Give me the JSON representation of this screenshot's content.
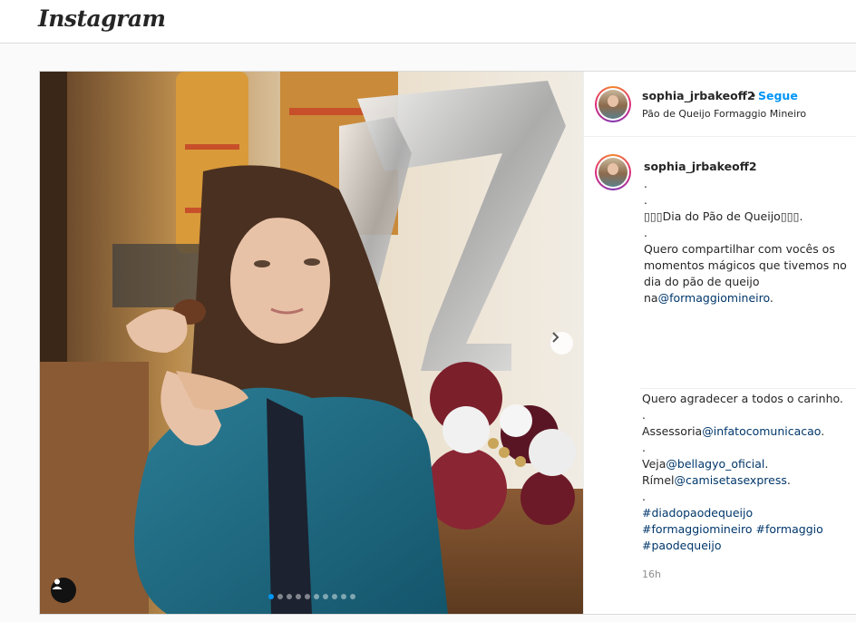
{
  "app": {
    "logo_text": "Instagram"
  },
  "post": {
    "username": "sophia_jrbakeoff2",
    "follow_separator": "•",
    "follow_label": "Segue",
    "location": "Pão de Queijo Formaggio Mineiro",
    "carousel": {
      "total": 10,
      "active_index": 0
    },
    "caption_username": "sophia_jrbakeoff2",
    "caption_lines": [
      {
        "text": ".",
        "link": ""
      },
      {
        "text": ".",
        "link": ""
      },
      {
        "text": "▯▯▯Dia do Pão de Queijo▯▯▯.",
        "link": ""
      },
      {
        "text": ".",
        "link": ""
      },
      {
        "text": "Quero compartilhar com vocês os",
        "link": ""
      },
      {
        "text": "momentos mágicos que tivemos no",
        "link": ""
      },
      {
        "text": "dia do pão de queijo",
        "link": ""
      },
      {
        "text": "na",
        "link": "@formaggiomineiro",
        "after": "."
      }
    ],
    "caption_lines_2": [
      {
        "text": "Quero agradecer a todos o carinho.",
        "link": ""
      },
      {
        "text": ".",
        "link": ""
      },
      {
        "text": "Assessoria",
        "link": "@infatocomunicacao",
        "after": "."
      },
      {
        "text": ".",
        "link": ""
      },
      {
        "text": "Veja",
        "link": "@bellagyo_oficial",
        "after": "."
      },
      {
        "text": "Rímel",
        "link": "@camisetasexpress",
        "after": "."
      },
      {
        "text": ".",
        "link": ""
      },
      {
        "text": "",
        "link": "#diadopaodequeijo"
      },
      {
        "text": "",
        "link": "#formaggiomineiro #formaggio"
      },
      {
        "text": "",
        "link": "#paodequeijo"
      }
    ],
    "timestamp": "16h"
  },
  "icons": {
    "next": "chevron-right-icon",
    "user_tag": "person-icon"
  },
  "colors": {
    "link": "#00376b",
    "follow": "#0095f6",
    "border": "#dbdbdb"
  }
}
